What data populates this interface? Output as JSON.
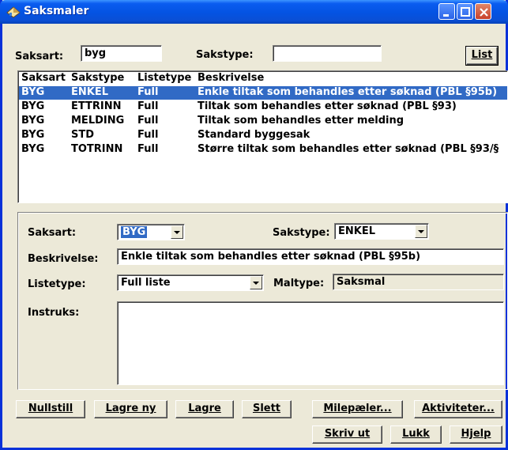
{
  "window": {
    "title": "Saksmaler"
  },
  "search": {
    "saksart_label": "Saksart:",
    "saksart_value": "byg",
    "sakstype_label": "Sakstype:",
    "sakstype_value": "",
    "list_button": "List"
  },
  "list": {
    "headers": [
      "Saksart",
      "Sakstype",
      "Listetype",
      "Beskrivelse"
    ],
    "rows": [
      [
        "BYG",
        "ENKEL",
        "Full",
        "Enkle tiltak som behandles etter søknad (PBL §95b)"
      ],
      [
        "BYG",
        "ETTRINN",
        "Full",
        "Tiltak som behandles etter søknad (PBL §93)"
      ],
      [
        "BYG",
        "MELDING",
        "Full",
        "Tiltak som behandles etter melding"
      ],
      [
        "BYG",
        "STD",
        "Full",
        "Standard byggesak"
      ],
      [
        "BYG",
        "TOTRINN",
        "Full",
        "Større tiltak som behandles etter søknad (PBL §93/§"
      ]
    ],
    "selected_index": 0
  },
  "detail": {
    "saksart_label": "Saksart:",
    "saksart_value": "BYG",
    "sakstype_label": "Sakstype:",
    "sakstype_value": "ENKEL",
    "beskrivelse_label": "Beskrivelse:",
    "beskrivelse_value": "Enkle tiltak som behandles etter søknad (PBL §95b)",
    "listetype_label": "Listetype:",
    "listetype_value": "Full liste",
    "maltype_label": "Maltype:",
    "maltype_value": "Saksmal",
    "instruks_label": "Instruks:",
    "instruks_value": ""
  },
  "buttons": {
    "nullstill": "Nullstill",
    "lagre_ny": "Lagre ny",
    "lagre": "Lagre",
    "slett": "Slett",
    "milepaeler": "Milepæler...",
    "aktiviteter": "Aktiviteter...",
    "skriv_ut": "Skriv ut",
    "lukk": "Lukk",
    "hjelp": "Hjelp"
  },
  "colors": {
    "titlebar": "#0453e2",
    "selection": "#316ac5",
    "face": "#ece9d8"
  }
}
